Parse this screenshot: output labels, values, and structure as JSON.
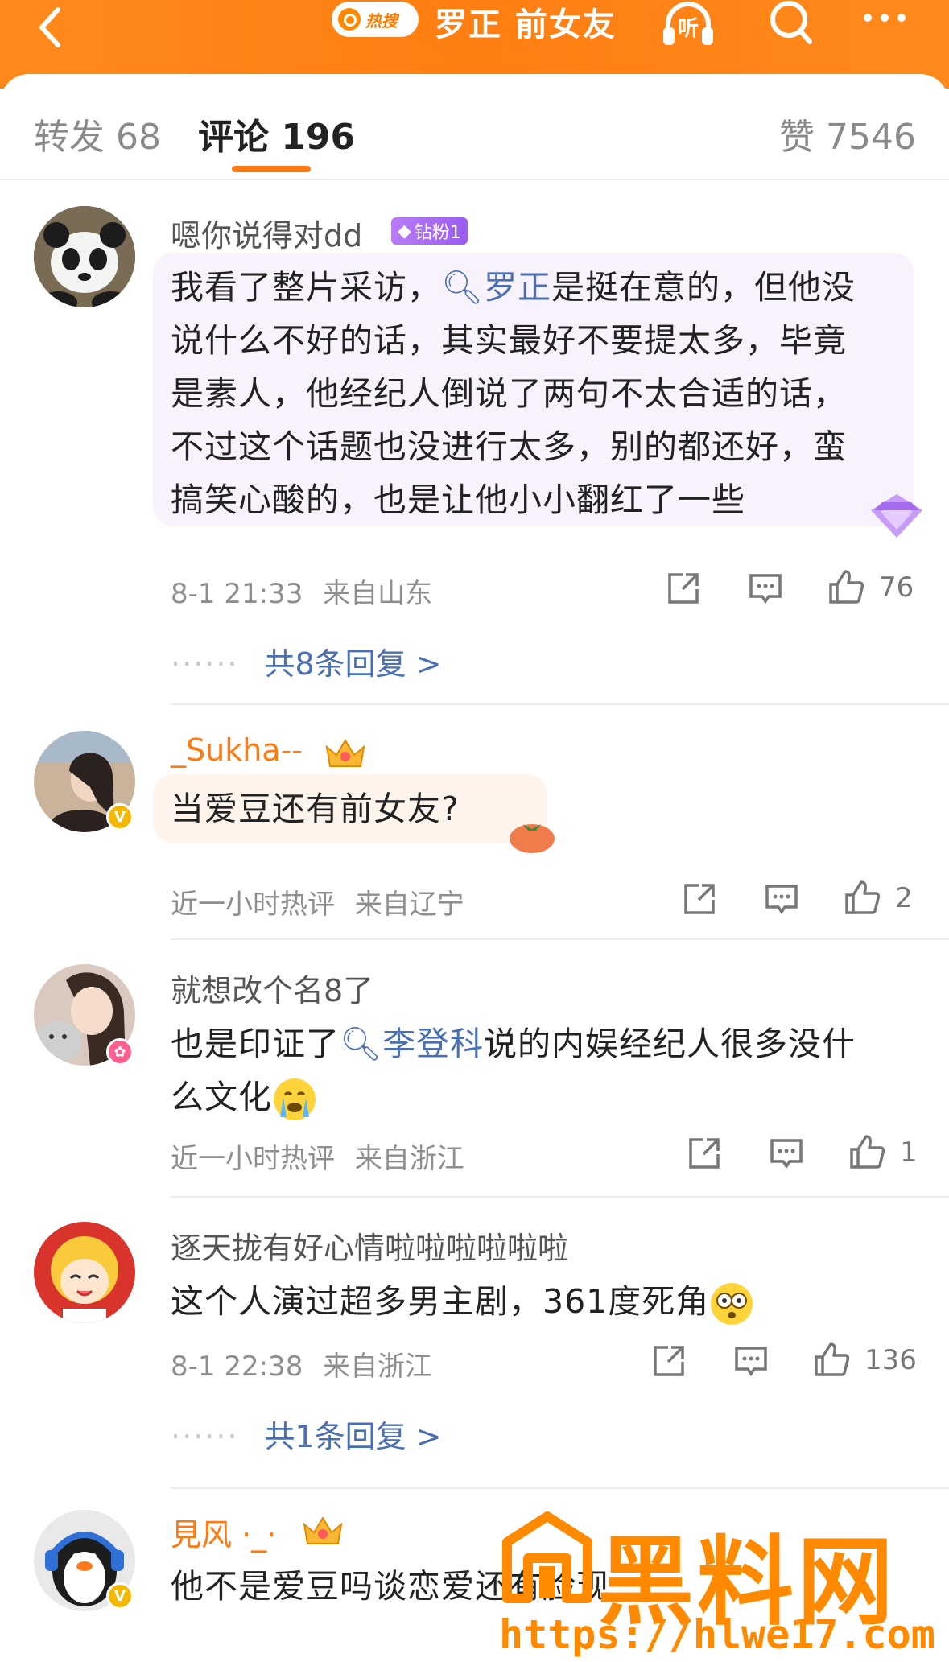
{
  "header": {
    "hot_label": "热搜",
    "title": "罗正 前女友",
    "listen_label": "听"
  },
  "tabs": {
    "repost": "转发 68",
    "comments": "评论 196",
    "likes": "赞 7546"
  },
  "comments": [
    {
      "user": "嗯你说得对dd",
      "badge": "钻粉1",
      "text_before": "我看了整片采访，",
      "topic": "罗正",
      "text_after": "是挺在意的，但他没说什么不好的话，其实最好不要提太多，毕竟是素人，他经纪人倒说了两句不太合适的话，不过这个话题也没进行太多，别的都还好，蛮搞笑心酸的，也是让他小小翻红了一些",
      "lines": [
        "我看了整片采访，",
        "说什么不好的话，其实最好不要提太多，毕竟",
        "是素人，他经纪人倒说了两句不太合适的话，",
        "不过这个话题也没进行太多，别的都还好，蛮",
        "搞笑心酸的，也是让他小小翻红了一些"
      ],
      "line1_tail": "是挺在意的，但他没",
      "time": "8-1 21:33",
      "location": "来自山东",
      "like_count": "76",
      "replies": "共8条回复 >"
    },
    {
      "user": "_Sukha--",
      "text": "当爱豆还有前女友?",
      "time": "近一小时热评",
      "location": "来自辽宁",
      "like_count": "2"
    },
    {
      "user": "就想改个名8了",
      "text_before": "也是印证了",
      "topic": "李登科",
      "text_after": "说的内娱经纪人很多没什",
      "line2": "么文化",
      "time": "近一小时热评",
      "location": "来自浙江",
      "like_count": "1"
    },
    {
      "user": "逐天拢有好心情啦啦啦啦啦啦",
      "text": "这个人演过超多男主剧，361度死角",
      "time": "8-1 22:38",
      "location": "来自浙江",
      "like_count": "136",
      "replies": "共1条回复 >"
    },
    {
      "user": "見风 ·_·",
      "text": "他不是爱豆吗谈恋爱还有脸现"
    }
  ],
  "watermark": {
    "main": "黑料网",
    "url": "https://hlwe17.com"
  },
  "colors": {
    "header": "#ff7e12",
    "accent": "#ff7a12",
    "link": "#4a6fb3",
    "vip": "#9b5cf0"
  }
}
